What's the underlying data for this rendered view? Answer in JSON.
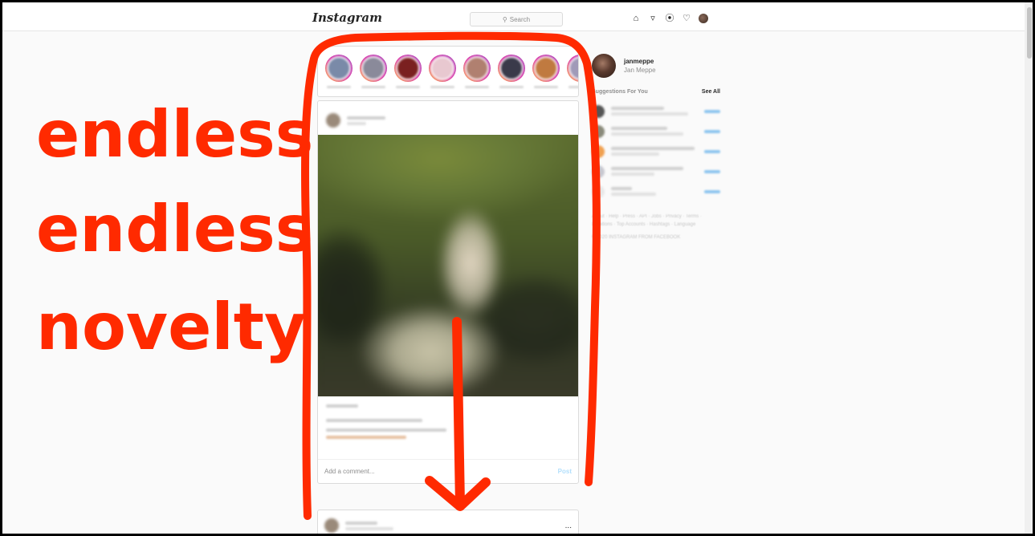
{
  "topbar": {
    "logo": "Instagram",
    "search_placeholder": "Search",
    "icons": [
      "home-icon",
      "direct-icon",
      "explore-icon",
      "heart-icon",
      "profile-icon"
    ]
  },
  "stories": {
    "count": 8
  },
  "post": {
    "comment_placeholder": "Add a comment...",
    "post_label": "Post"
  },
  "post2": {
    "more_label": "..."
  },
  "sidebar": {
    "username": "janmeppe",
    "name": "Jan Meppe",
    "suggestions_title": "Suggestions For You",
    "see_all": "See All",
    "footer_links": "About · Help · Press · API · Jobs · Privacy · Terms · Locations · Top Accounts · Hashtags · Language",
    "copyright": "© 2020 INSTAGRAM FROM FACEBOOK"
  },
  "annotation": {
    "line1": "endless",
    "line2": "endless",
    "line3": "novelty",
    "color": "#ff2a00"
  }
}
